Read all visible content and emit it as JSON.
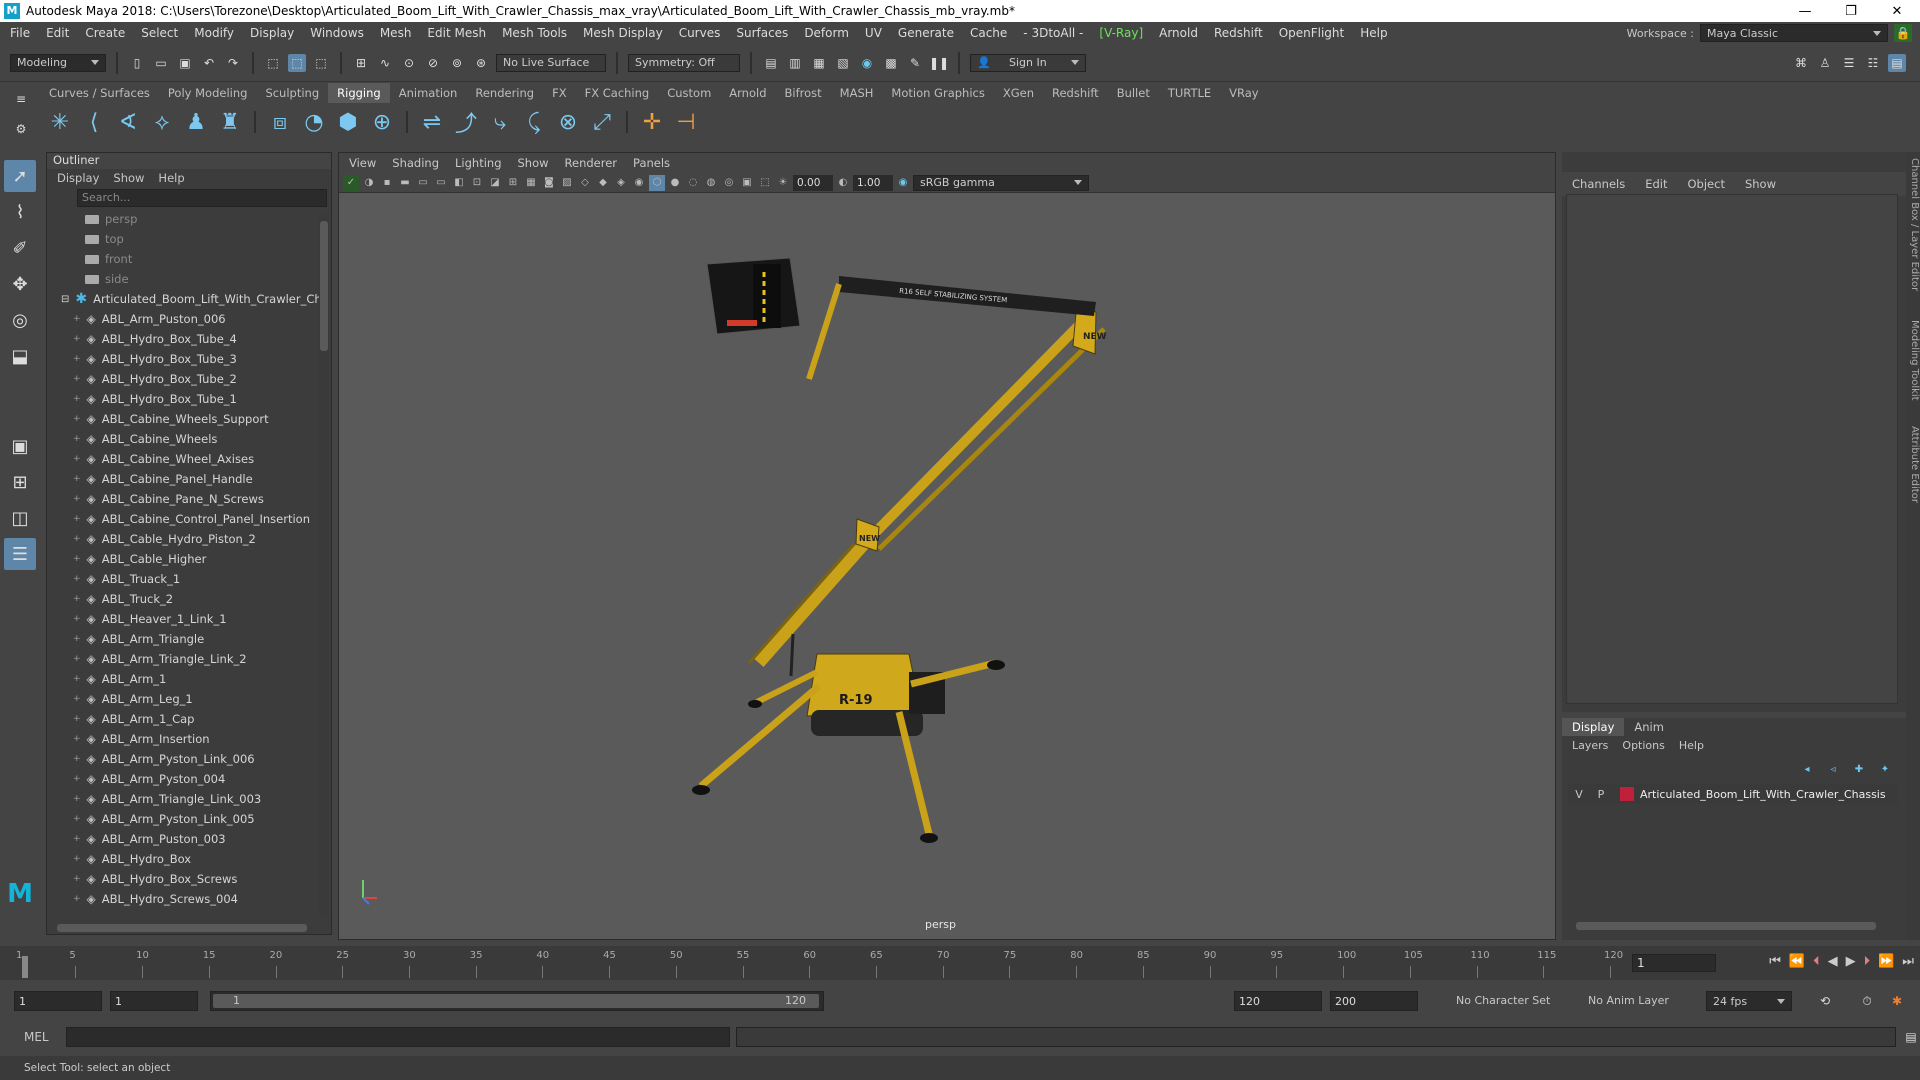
{
  "window": {
    "title": "Autodesk Maya 2018: C:\\Users\\Torezone\\Desktop\\Articulated_Boom_Lift_With_Crawler_Chassis_max_vray\\Articulated_Boom_Lift_With_Crawler_Chassis_mb_vray.mb*",
    "min": "—",
    "max": "❐",
    "close": "✕"
  },
  "menubar": {
    "items": [
      "File",
      "Edit",
      "Create",
      "Select",
      "Modify",
      "Display",
      "Windows",
      "Mesh",
      "Edit Mesh",
      "Mesh Tools",
      "Mesh Display",
      "Curves",
      "Surfaces",
      "Deform",
      "UV",
      "Generate",
      "Cache",
      "- 3DtoAll -"
    ],
    "vray": "[V-Ray]",
    "items2": [
      "Arnold",
      "Redshift",
      "OpenFlight",
      "Help"
    ],
    "workspace_label": "Workspace :",
    "workspace_value": "Maya Classic"
  },
  "statusline": {
    "mode": "Modeling",
    "live_surface": "No Live Surface",
    "symmetry": "Symmetry: Off",
    "sign_in": "Sign In"
  },
  "shelf": {
    "tabs": [
      "Curves / Surfaces",
      "Poly Modeling",
      "Sculpting",
      "Rigging",
      "Animation",
      "Rendering",
      "FX",
      "FX Caching",
      "Custom",
      "Arnold",
      "Bifrost",
      "MASH",
      "Motion Graphics",
      "XGen",
      "Redshift",
      "Bullet",
      "TURTLE",
      "VRay"
    ],
    "active": "Rigging"
  },
  "outliner": {
    "title": "Outliner",
    "menus": [
      "Display",
      "Show",
      "Help"
    ],
    "search_placeholder": "Search...",
    "cameras": [
      "persp",
      "top",
      "front",
      "side"
    ],
    "group": "Articulated_Boom_Lift_With_Crawler_Chas",
    "items": [
      "ABL_Arm_Puston_006",
      "ABL_Hydro_Box_Tube_4",
      "ABL_Hydro_Box_Tube_3",
      "ABL_Hydro_Box_Tube_2",
      "ABL_Hydro_Box_Tube_1",
      "ABL_Cabine_Wheels_Support",
      "ABL_Cabine_Wheels",
      "ABL_Cabine_Wheel_Axises",
      "ABL_Cabine_Panel_Handle",
      "ABL_Cabine_Pane_N_Screws",
      "ABL_Cabine_Control_Panel_Insertion",
      "ABL_Cable_Hydro_Piston_2",
      "ABL_Cable_Higher",
      "ABL_Truack_1",
      "ABL_Truck_2",
      "ABL_Heaver_1_Link_1",
      "ABL_Arm_Triangle",
      "ABL_Arm_Triangle_Link_2",
      "ABL_Arm_1",
      "ABL_Arm_Leg_1",
      "ABL_Arm_1_Cap",
      "ABL_Arm_Insertion",
      "ABL_Arm_Pyston_Link_006",
      "ABL_Arm_Pyston_004",
      "ABL_Arm_Triangle_Link_003",
      "ABL_Arm_Pyston_Link_005",
      "ABL_Arm_Puston_003",
      "ABL_Hydro_Box",
      "ABL_Hydro_Box_Screws",
      "ABL_Hydro_Screws_004"
    ]
  },
  "viewport": {
    "menus": [
      "View",
      "Shading",
      "Lighting",
      "Show",
      "Renderer",
      "Panels"
    ],
    "exposure": "0.00",
    "gamma": "1.00",
    "colorspace": "sRGB gamma",
    "camera": "persp",
    "decal_top": "R16  SELF STABILIZING SYSTEM",
    "decal_new": "NEW",
    "decal_model": "R-19"
  },
  "channelbox": {
    "menus": [
      "Channels",
      "Edit",
      "Object",
      "Show"
    ]
  },
  "layers": {
    "tabs": [
      "Display",
      "Anim"
    ],
    "menus": [
      "Layers",
      "Options",
      "Help"
    ],
    "layer_v": "V",
    "layer_p": "P",
    "layer_name": "Articulated_Boom_Lift_With_Crawler_Chassis",
    "layer_color": "#c0203a"
  },
  "sidetabs": [
    "Channel Box / Layer Editor",
    "Modeling Toolkit",
    "Attribute Editor"
  ],
  "timeslider": {
    "ticks": [
      "1",
      "5",
      "10",
      "15",
      "20",
      "25",
      "30",
      "35",
      "40",
      "45",
      "50",
      "55",
      "60",
      "65",
      "70",
      "75",
      "80",
      "85",
      "90",
      "95",
      "100",
      "105",
      "110",
      "115",
      "120"
    ],
    "current": "1"
  },
  "range": {
    "start": "1",
    "playstart": "1",
    "slider_start": "1",
    "slider_end": "120",
    "playend": "120",
    "end": "200",
    "character_set": "No Character Set",
    "anim_layer": "No Anim Layer",
    "fps": "24 fps"
  },
  "cmdline": {
    "label": "MEL"
  },
  "helpline": {
    "text": "Select Tool: select an object"
  }
}
